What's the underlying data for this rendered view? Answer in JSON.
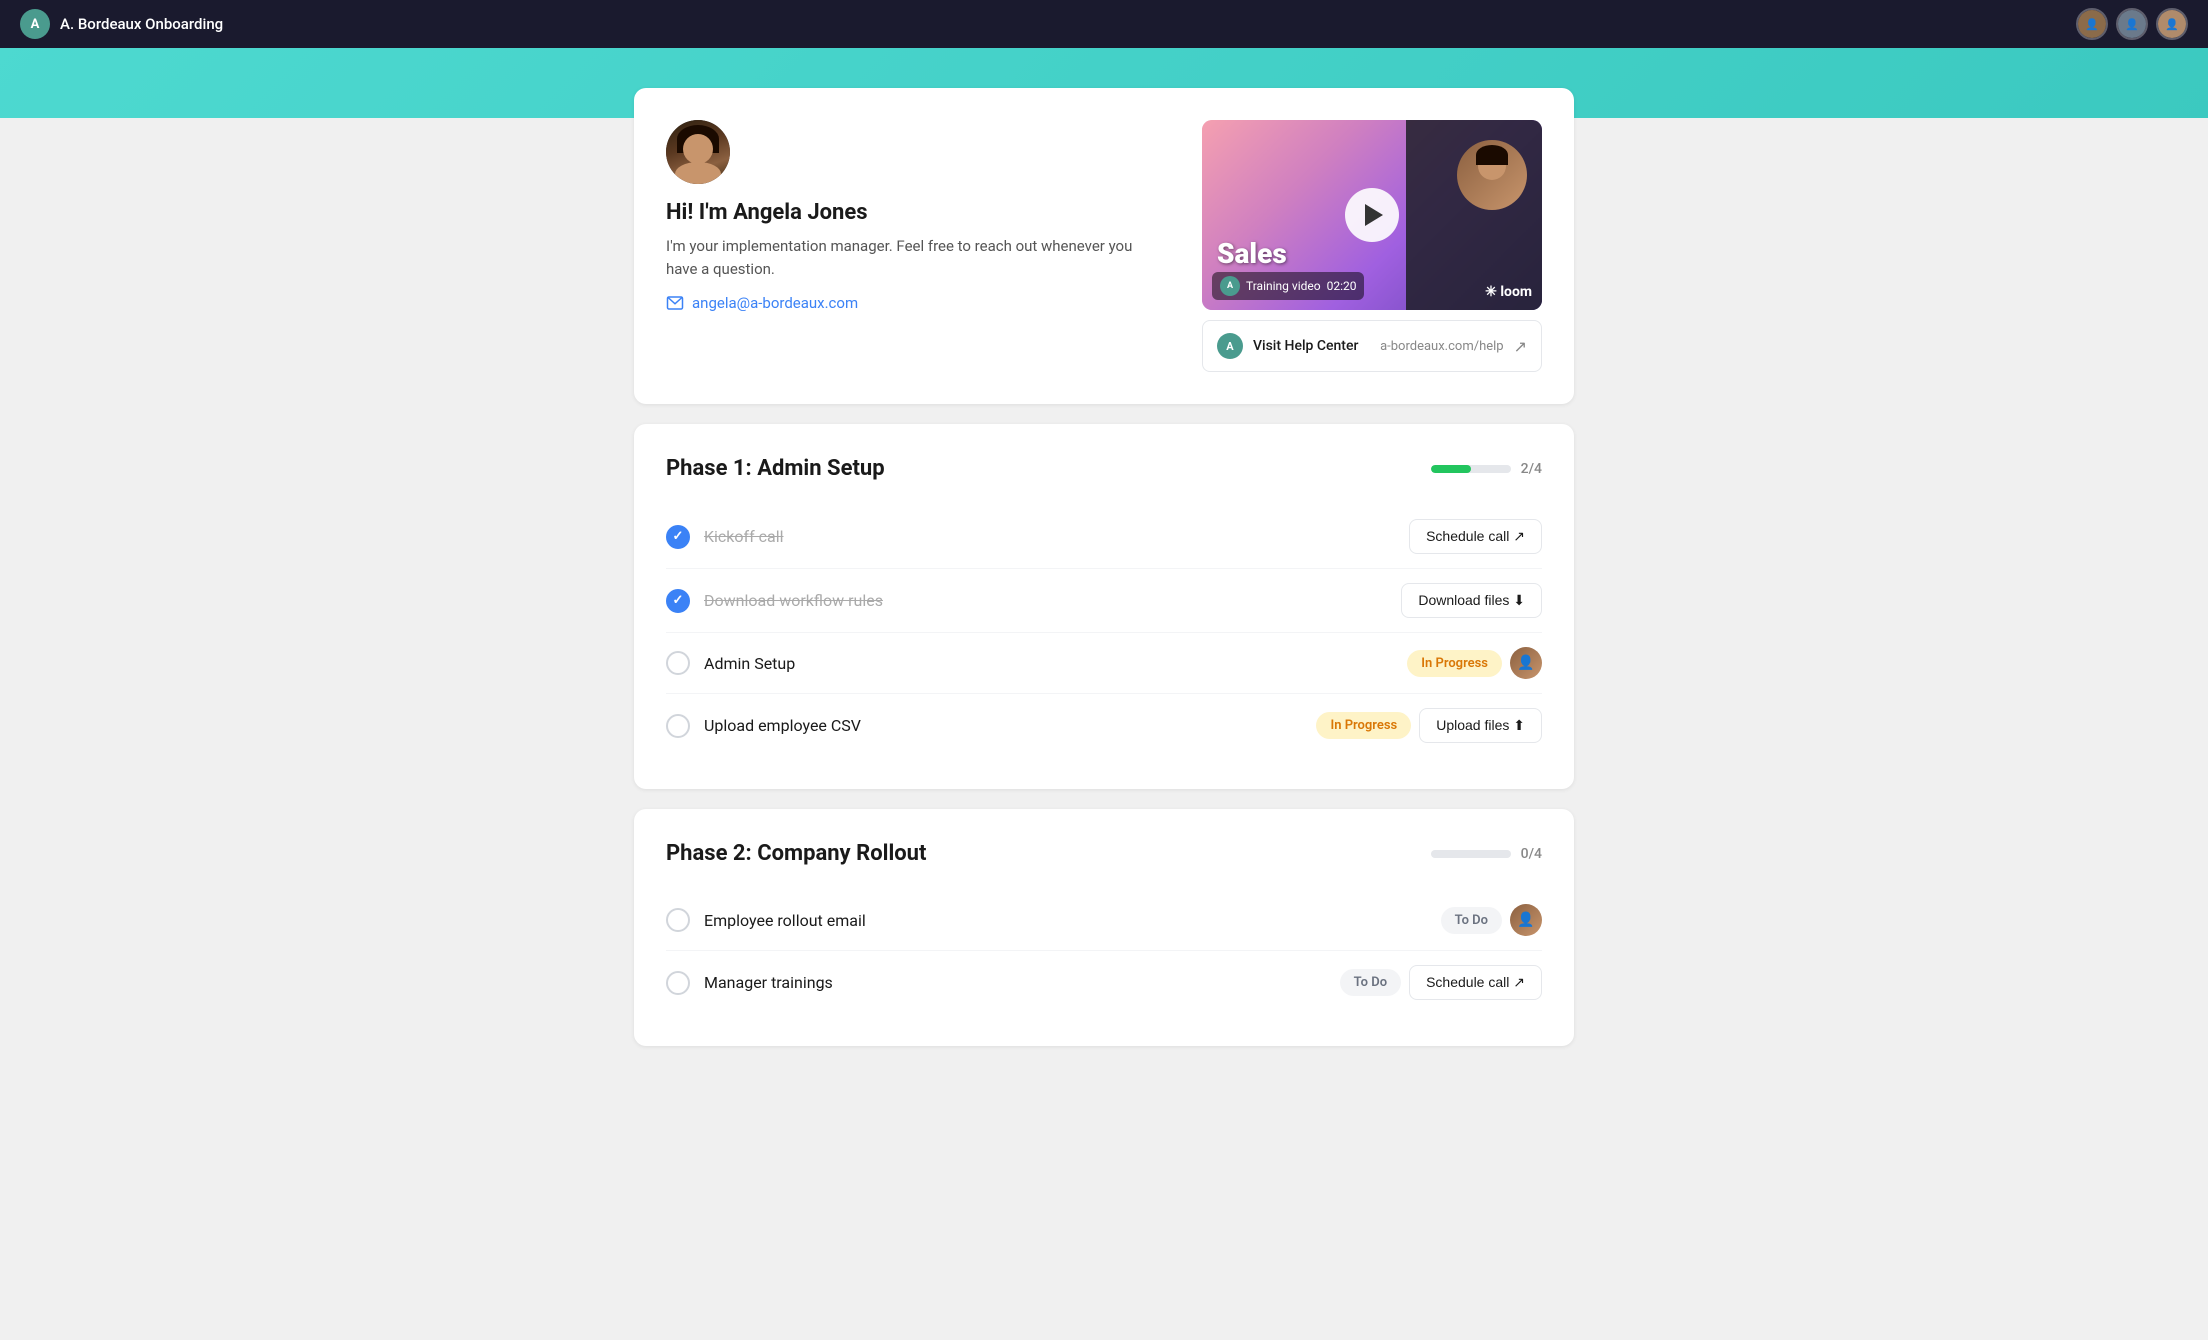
{
  "nav": {
    "title": "A. Bordeaux Onboarding",
    "avatar_initial": "A",
    "avatars": [
      "A1",
      "A2",
      "A3"
    ]
  },
  "intro": {
    "greeting": "Hi! I'm Angela Jones",
    "description": "I'm your implementation manager. Feel free to reach out whenever you have a question.",
    "email": "angela@a-bordeaux.com",
    "video": {
      "title": "Training video",
      "duration": "02:20",
      "avatar_initial": "A"
    },
    "help_center": {
      "label": "Visit Help Center",
      "url": "a-bordeaux.com/help",
      "avatar_initial": "A"
    }
  },
  "phases": [
    {
      "title": "Phase 1: Admin Setup",
      "progress_filled": 50,
      "progress_label": "2/4",
      "tasks": [
        {
          "id": "kickoff-call",
          "label": "Kickoff call",
          "checked": true,
          "strikethrough": true,
          "action_type": "button",
          "action_label": "Schedule call",
          "action_icon": "↗"
        },
        {
          "id": "download-workflow",
          "label": "Download workflow rules",
          "checked": true,
          "strikethrough": true,
          "action_type": "button",
          "action_label": "Download files",
          "action_icon": "⬇"
        },
        {
          "id": "admin-setup",
          "label": "Admin Setup",
          "checked": false,
          "strikethrough": false,
          "action_type": "badge+avatar",
          "badge_label": "In Progress",
          "badge_type": "in-progress"
        },
        {
          "id": "upload-csv",
          "label": "Upload employee CSV",
          "checked": false,
          "strikethrough": false,
          "action_type": "badge+button",
          "badge_label": "In Progress",
          "badge_type": "in-progress",
          "action_label": "Upload files",
          "action_icon": "⬆"
        }
      ]
    },
    {
      "title": "Phase 2: Company Rollout",
      "progress_filled": 0,
      "progress_label": "0/4",
      "progress_gray": true,
      "tasks": [
        {
          "id": "employee-rollout",
          "label": "Employee rollout email",
          "checked": false,
          "strikethrough": false,
          "action_type": "badge+avatar",
          "badge_label": "To Do",
          "badge_type": "to-do"
        },
        {
          "id": "manager-trainings",
          "label": "Manager trainings",
          "checked": false,
          "strikethrough": false,
          "action_type": "badge+button",
          "badge_label": "To Do",
          "badge_type": "to-do",
          "action_label": "Schedule call",
          "action_icon": "↗"
        }
      ]
    }
  ]
}
